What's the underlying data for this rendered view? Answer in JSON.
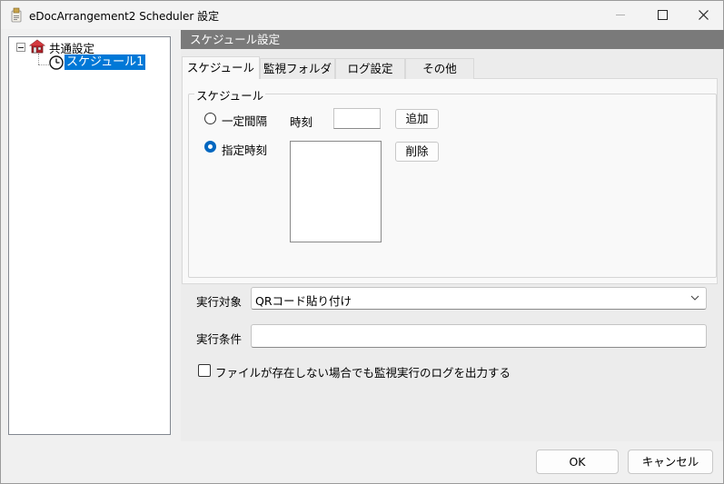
{
  "window": {
    "title": "eDocArrangement2 Scheduler 設定",
    "icons": {
      "app": "scheduler-app-icon",
      "minimize": "minimize-icon",
      "maximize": "maximize-icon",
      "close": "close-icon"
    }
  },
  "tree": {
    "root": {
      "label": "共通設定",
      "icon": "house-icon",
      "expanded": true
    },
    "children": [
      {
        "label": "スケジュール1",
        "icon": "clock-icon",
        "selected": true
      }
    ]
  },
  "panel": {
    "header": "スケジュール設定",
    "tabs": [
      {
        "label": "スケジュール",
        "active": true
      },
      {
        "label": "監視フォルダ",
        "active": false
      },
      {
        "label": "ログ設定",
        "active": false
      },
      {
        "label": "その他",
        "active": false
      }
    ],
    "schedule_group": {
      "title": "スケジュール",
      "radio_interval": {
        "label": "一定間隔",
        "checked": false
      },
      "radio_specified": {
        "label": "指定時刻",
        "checked": true
      },
      "time_label": "時刻",
      "time_value": "",
      "add_button": "追加",
      "delete_button": "削除",
      "time_list": []
    },
    "target": {
      "label": "実行対象",
      "value": "QRコード貼り付け"
    },
    "condition": {
      "label": "実行条件",
      "value": ""
    },
    "log_checkbox": {
      "label": "ファイルが存在しない場合でも監視実行のログを出力する",
      "checked": false
    }
  },
  "footer": {
    "ok": "OK",
    "cancel": "キャンセル"
  },
  "colors": {
    "selection": "#0078d7",
    "header_bar": "#7a7a7a",
    "radio_accent": "#0067c0"
  }
}
